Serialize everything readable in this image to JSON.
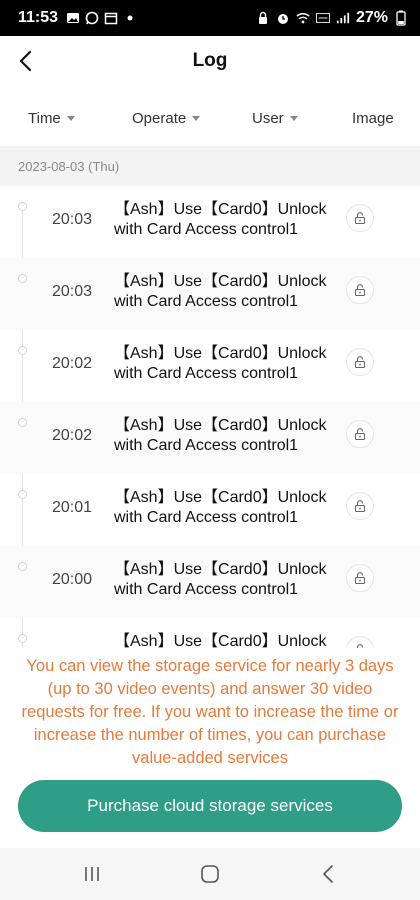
{
  "status_bar": {
    "time": "11:53",
    "battery": "27%",
    "left_icons": [
      "gallery-icon",
      "whatsapp-icon",
      "calendar-icon",
      "dot-icon"
    ],
    "right_icons": [
      "alarm-lock-icon",
      "alarm-icon",
      "wifi-icon",
      "volte-icon",
      "signal-icon"
    ]
  },
  "header": {
    "title": "Log",
    "back_icon": "chevron-left-icon"
  },
  "filters": [
    {
      "label": "Time",
      "has_dropdown": true
    },
    {
      "label": "Operate",
      "has_dropdown": true
    },
    {
      "label": "User",
      "has_dropdown": true
    },
    {
      "label": "Image",
      "has_dropdown": false
    }
  ],
  "date_header": "2023-08-03 (Thu)",
  "logs": [
    {
      "time": "20:03",
      "text": "【Ash】Use【Card0】Unlock with Card Access control1",
      "icon": "unlock-icon"
    },
    {
      "time": "20:03",
      "text": "【Ash】Use【Card0】Unlock with Card Access control1",
      "icon": "unlock-icon"
    },
    {
      "time": "20:02",
      "text": "【Ash】Use【Card0】Unlock with Card Access control1",
      "icon": "unlock-icon"
    },
    {
      "time": "20:02",
      "text": "【Ash】Use【Card0】Unlock with Card Access control1",
      "icon": "unlock-icon"
    },
    {
      "time": "20:01",
      "text": "【Ash】Use【Card0】Unlock with Card Access control1",
      "icon": "unlock-icon"
    },
    {
      "time": "20:00",
      "text": "【Ash】Use【Card0】Unlock with Card Access control1",
      "icon": "unlock-icon"
    },
    {
      "time": "",
      "text": "【Ash】Use【Card0】Unlock",
      "icon": "unlock-icon"
    }
  ],
  "info_notice": "You can view the storage service for nearly 3 days (up to 30 video events) and answer 30 video requests for free. If you want to increase the time or increase the number of times, you can purchase value-added services",
  "purchase_button": "Purchase cloud storage services",
  "colors": {
    "accent": "#2e9e87",
    "notice": "#e57a3b"
  },
  "nav_bar": [
    "recent-apps-icon",
    "home-icon",
    "back-icon"
  ]
}
